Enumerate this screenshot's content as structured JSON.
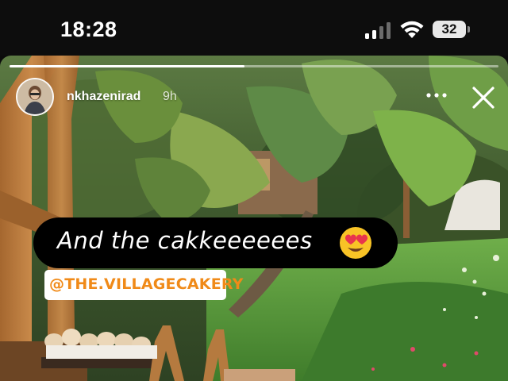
{
  "status_bar": {
    "time": "18:28",
    "battery_level": "32",
    "signal_bars_active": 2,
    "signal_bars_total": 4
  },
  "story": {
    "username": "nkhazenirad",
    "time_ago": "9h",
    "progress_fraction": 0.48,
    "caption": "And the cakkeeeeees",
    "caption_emoji": "heart-eyes-emoji",
    "mention": "@THE.VILLAGECAKERY",
    "icons": [
      "more-icon",
      "close-icon"
    ]
  },
  "colors": {
    "mention_text": "#f08a18",
    "caption_bg": "#000000",
    "mention_bg": "#ffffff"
  }
}
